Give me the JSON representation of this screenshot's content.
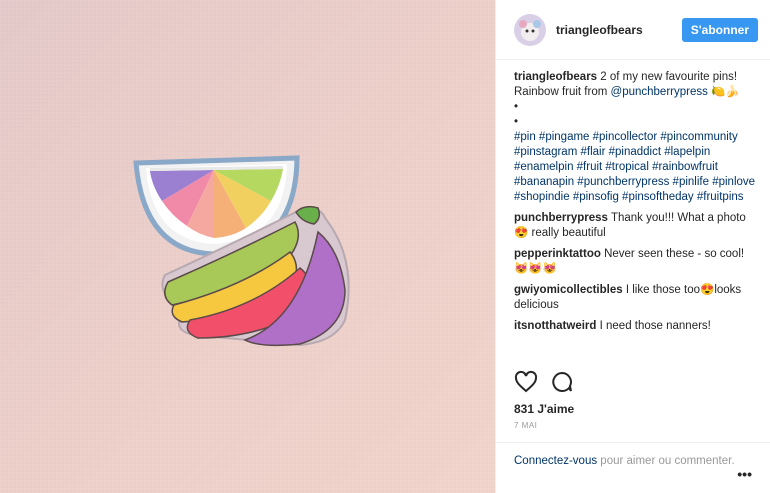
{
  "post": {
    "username": "triangleofbears",
    "follow_label": "S'abonner",
    "caption": {
      "username": "triangleofbears",
      "text": " 2 of my new favourite pins! Rainbow fruit from ",
      "mention": "@punchberrypress",
      "emoji": " 🍋🍌",
      "dots": [
        "•",
        "•"
      ],
      "hashtags": "#pin #pingame #pincollector #pincommunity #pinstagram #flair #pinaddict #lapelpin #enamelpin #fruit #tropical #rainbowfruit #bananapin #punchberrypress #pinlife #pinlove #shopindie #pinsofig #pinsoftheday #fruitpins"
    },
    "comments": [
      {
        "user": "punchberrypress",
        "text": " Thank you!!! What a photo 😍 really beautiful"
      },
      {
        "user": "pepperinktattoo",
        "text": " Never seen these - so cool! 😻😻😻"
      },
      {
        "user": "gwiyomicollectibles",
        "text": " I like those too😍looks delicious"
      },
      {
        "user": "itsnotthatweird",
        "text": " I need those nanners!"
      }
    ],
    "likes": "831 J'aime",
    "date": "7 mai",
    "login_link": "Connectez-vous",
    "login_rest": " pour aimer ou commenter.",
    "more": "•••"
  },
  "icons": {
    "like": "heart-icon",
    "comment": "comment-icon",
    "more": "more-options-icon"
  },
  "colors": {
    "follow_button": "#3897f0",
    "link": "#003569"
  }
}
